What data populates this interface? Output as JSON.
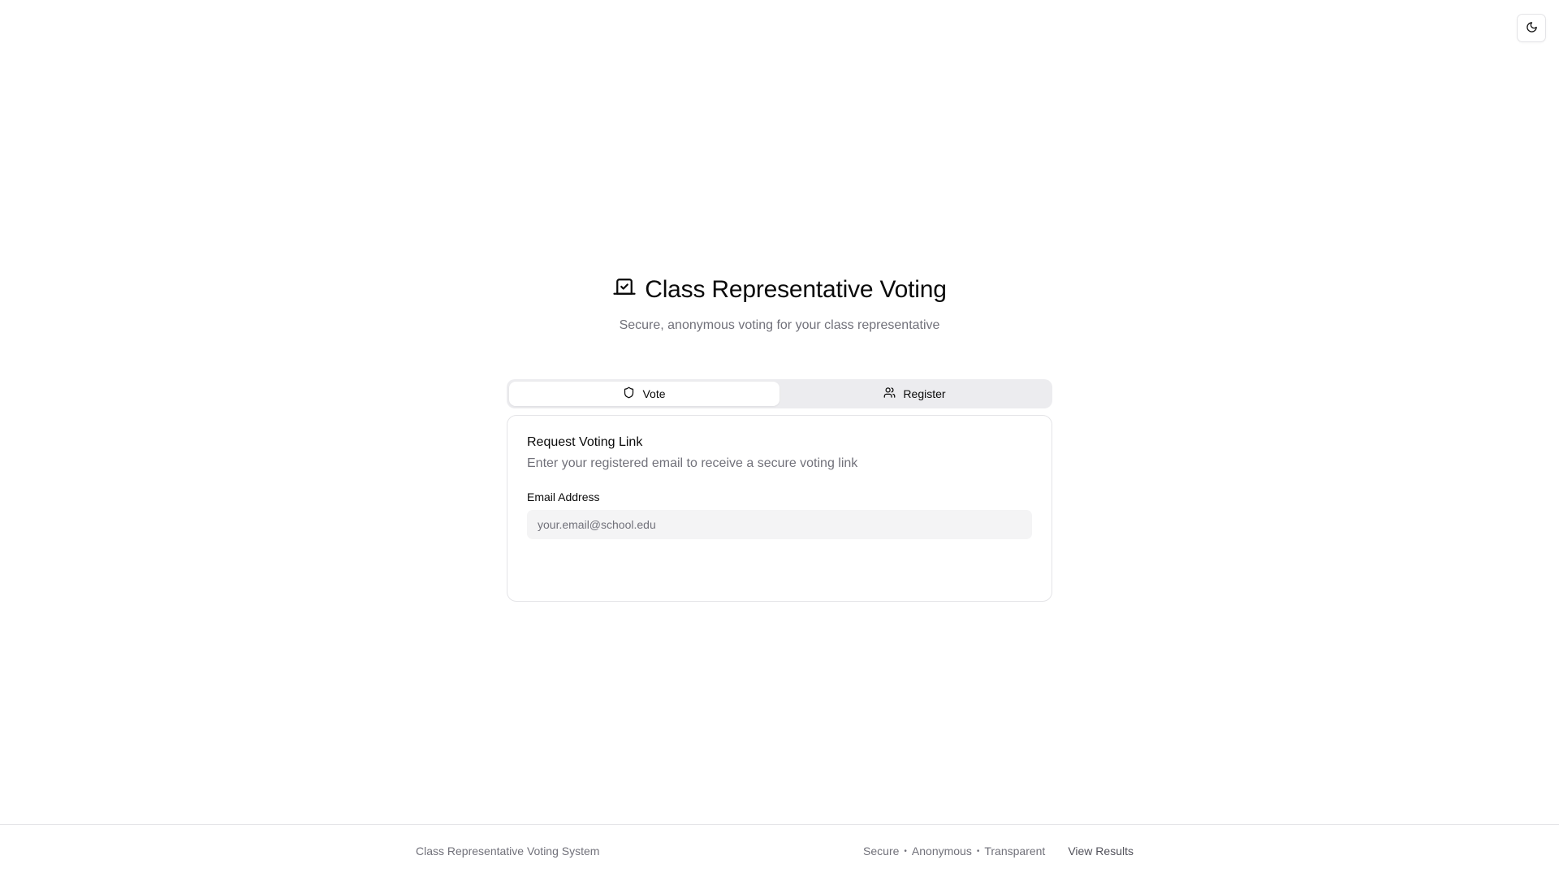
{
  "theme_toggle": {
    "icon": "moon-icon"
  },
  "hero": {
    "icon": "vote-box-icon",
    "title": "Class Representative Voting",
    "subtitle": "Secure, anonymous voting for your class representative"
  },
  "tabs": [
    {
      "label": "Vote",
      "icon": "shield-icon",
      "active": true
    },
    {
      "label": "Register",
      "icon": "users-icon",
      "active": false
    }
  ],
  "card": {
    "title": "Request Voting Link",
    "description": "Enter your registered email to receive a secure voting link",
    "email_label": "Email Address",
    "email_placeholder": "your.email@school.edu",
    "email_value": ""
  },
  "footer": {
    "left_text": "Class Representative Voting System",
    "tagline": [
      "Secure",
      "Anonymous",
      "Transparent"
    ],
    "separator": "•",
    "view_results_label": "View Results"
  },
  "colors": {
    "muted_text": "#71717a",
    "border": "#e4e4e7",
    "tab_track": "#ececef",
    "input_bg": "#f4f4f5"
  }
}
